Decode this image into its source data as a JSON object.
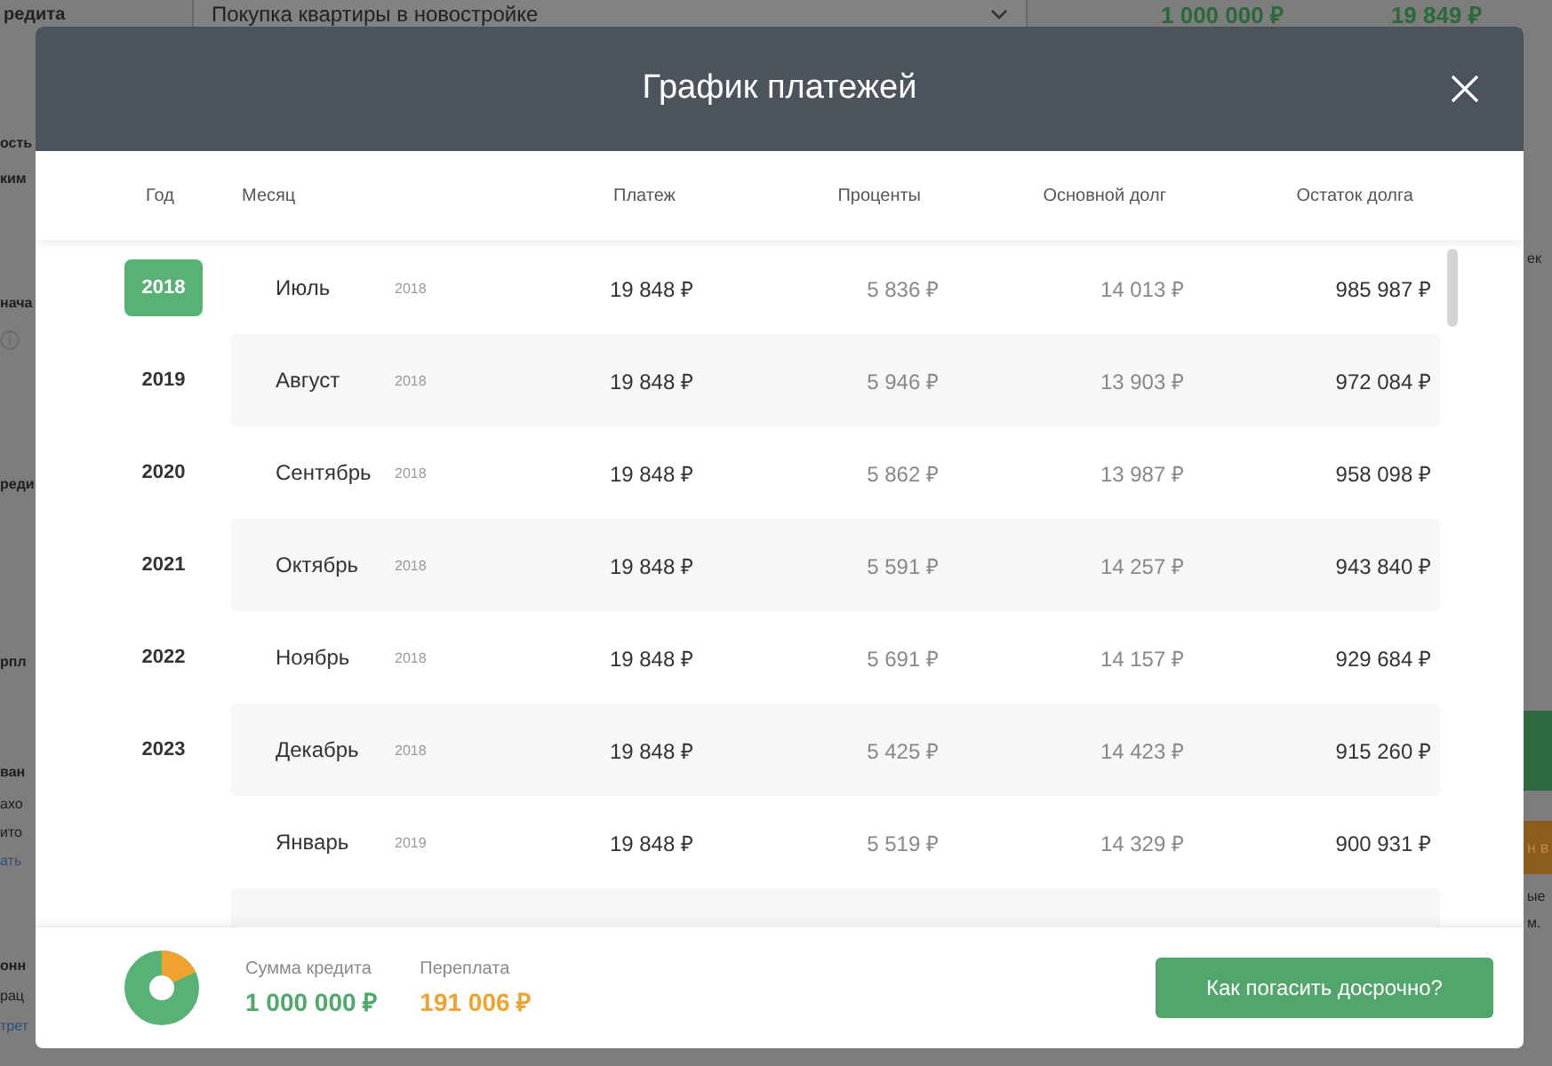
{
  "background": {
    "top": {
      "label": "редита",
      "select": "Покупка квартиры в новостройке",
      "amount": "1 000 000 ₽",
      "payment": "19 849 ₽"
    },
    "left_fragments": [
      {
        "text": "ость",
        "kind": "label"
      },
      {
        "text": "ким",
        "kind": "label"
      },
      {
        "text": "нача",
        "kind": "label"
      },
      {
        "kind": "info"
      },
      {
        "text": "реди",
        "kind": "label"
      },
      {
        "text": "рпл",
        "kind": "label"
      },
      {
        "text": "ван",
        "kind": "label"
      },
      {
        "text": "ахо",
        "kind": "text"
      },
      {
        "text": "ито",
        "kind": "text"
      },
      {
        "text": "ать",
        "kind": "link"
      },
      {
        "text": "онн",
        "kind": "label"
      },
      {
        "text": "рац",
        "kind": "text"
      },
      {
        "text": "трет",
        "kind": "link"
      }
    ],
    "right_fragments": [
      {
        "text": "ек",
        "kind": "text"
      },
      {
        "kind": "green"
      },
      {
        "text": "н в",
        "kind": "orange"
      },
      {
        "text": "ые",
        "kind": "text"
      },
      {
        "text": "м.",
        "kind": "text"
      }
    ]
  },
  "modal": {
    "title": "График платежей",
    "columns": [
      "Год",
      "Месяц",
      "Платеж",
      "Проценты",
      "Основной долг",
      "Остаток долга"
    ],
    "years": [
      {
        "label": "2018",
        "selected": true
      },
      {
        "label": "2019",
        "selected": false
      },
      {
        "label": "2020",
        "selected": false
      },
      {
        "label": "2021",
        "selected": false
      },
      {
        "label": "2022",
        "selected": false
      },
      {
        "label": "2023",
        "selected": false
      }
    ],
    "rows": [
      {
        "month": "Июль",
        "year": "2018",
        "payment": "19 848 ₽",
        "interest": "5 836 ₽",
        "principal": "14 013 ₽",
        "balance": "985 987 ₽"
      },
      {
        "month": "Август",
        "year": "2018",
        "payment": "19 848 ₽",
        "interest": "5 946 ₽",
        "principal": "13 903 ₽",
        "balance": "972 084 ₽"
      },
      {
        "month": "Сентябрь",
        "year": "2018",
        "payment": "19 848 ₽",
        "interest": "5 862 ₽",
        "principal": "13 987 ₽",
        "balance": "958 098 ₽"
      },
      {
        "month": "Октябрь",
        "year": "2018",
        "payment": "19 848 ₽",
        "interest": "5 591 ₽",
        "principal": "14 257 ₽",
        "balance": "943 840 ₽"
      },
      {
        "month": "Ноябрь",
        "year": "2018",
        "payment": "19 848 ₽",
        "interest": "5 691 ₽",
        "principal": "14 157 ₽",
        "balance": "929 684 ₽"
      },
      {
        "month": "Декабрь",
        "year": "2018",
        "payment": "19 848 ₽",
        "interest": "5 425 ₽",
        "principal": "14 423 ₽",
        "balance": "915 260 ₽"
      },
      {
        "month": "Январь",
        "year": "2019",
        "payment": "19 848 ₽",
        "interest": "5 519 ₽",
        "principal": "14 329 ₽",
        "balance": "900 931 ₽"
      }
    ],
    "footer": {
      "loan_label": "Сумма кредита",
      "loan_value": "1 000 000 ₽",
      "overpay_label": "Переплата",
      "overpay_value": "191 006 ₽",
      "button": "Как погасить досрочно?"
    }
  }
}
